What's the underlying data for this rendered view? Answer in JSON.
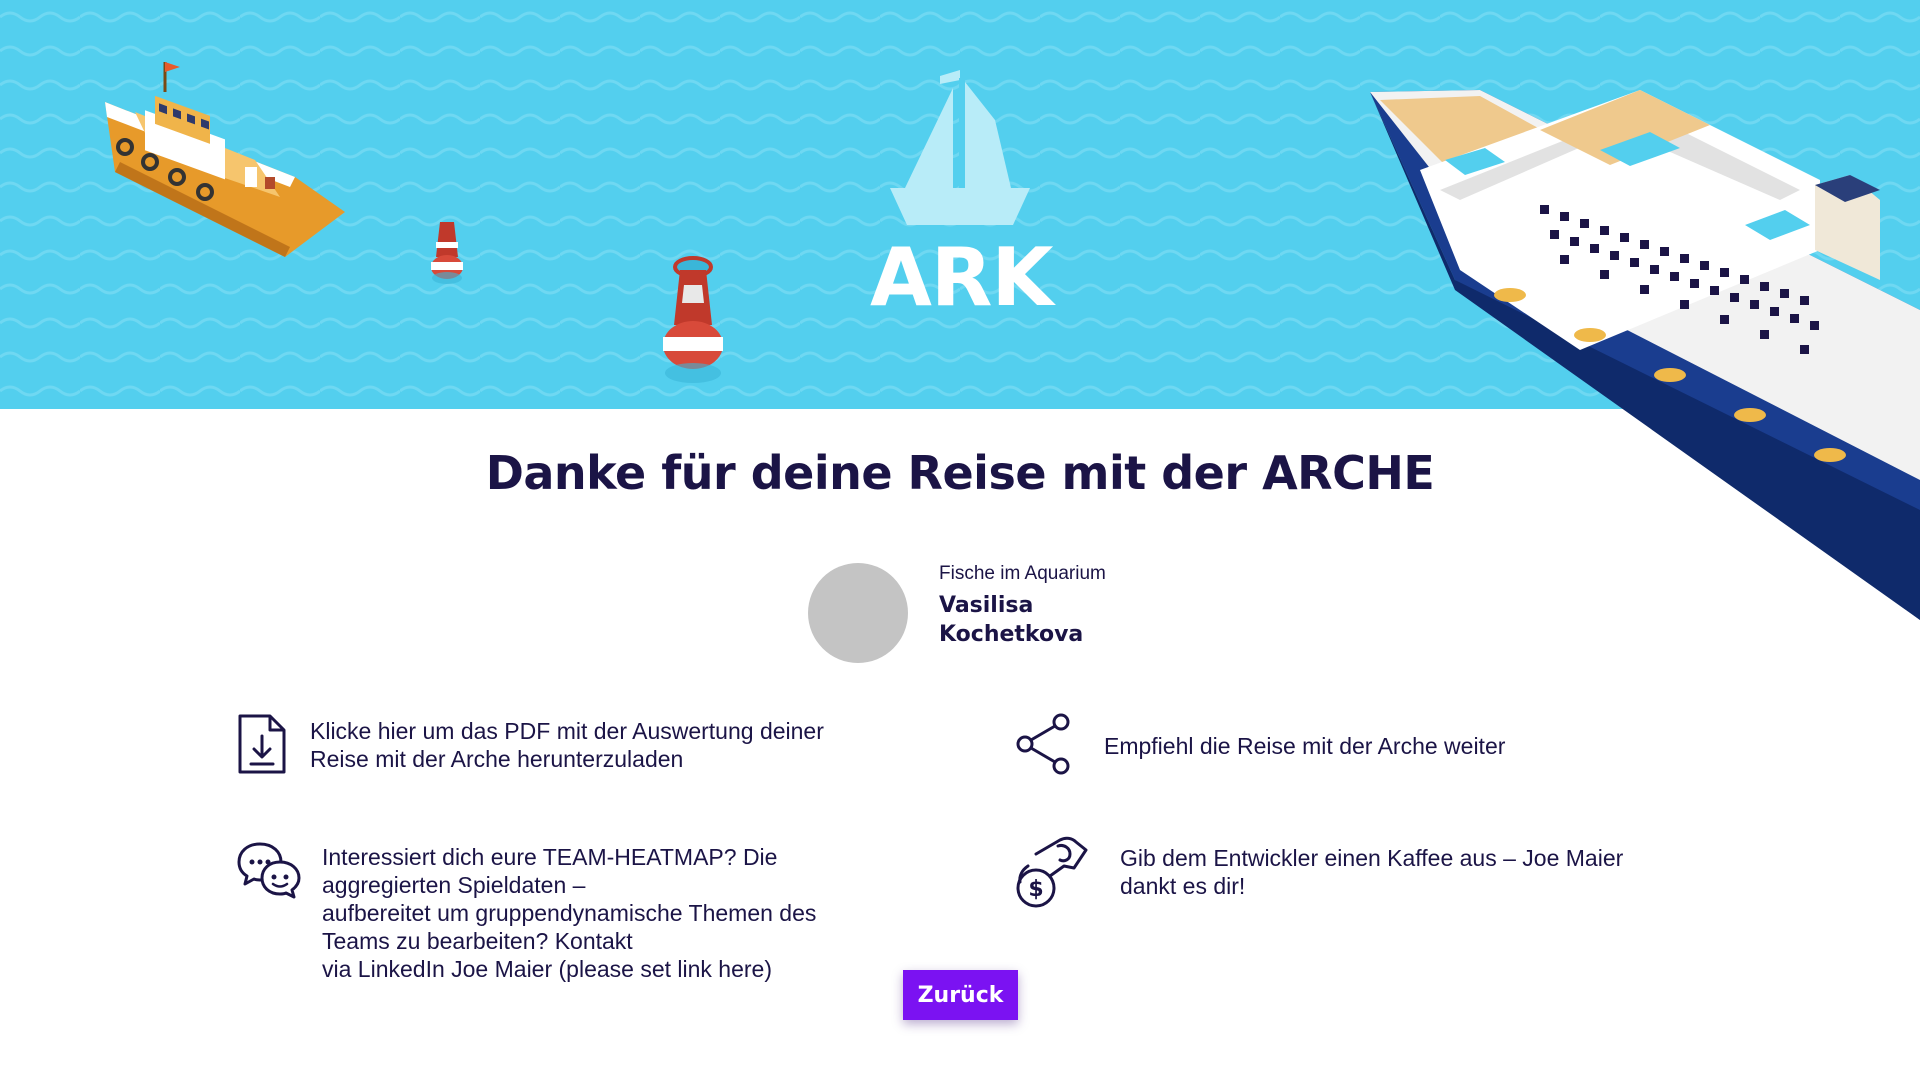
{
  "header": {
    "logo_text": "ARK"
  },
  "main": {
    "title": "Danke für deine Reise mit der ARCHE",
    "player": {
      "team": "Fische im Aquarium",
      "name": "Vasilisa Kochetkova"
    },
    "actions": {
      "pdf": "Klicke hier um das PDF mit der Auswertung deiner\nReise mit der Arche herunterzuladen",
      "share": "Empfiehl die Reise mit der Arche weiter",
      "heatmap": "Interessiert dich eure TEAM-HEATMAP? Die\naggregierten Spieldaten –\naufbereitet um gruppendynamische Themen des\nTeams zu bearbeiten? Kontakt\nvia LinkedIn Joe Maier (please set link here)",
      "coffee": "Gib dem Entwickler einen Kaffee aus – Joe Maier\ndankt es dir!"
    },
    "back_label": "Zurück"
  },
  "colors": {
    "sea": "#53cfee",
    "text": "#1b1446",
    "accent": "#7b12f2",
    "avatar_placeholder": "#c4c4c4"
  },
  "icons": {
    "pdf": "file-download-icon",
    "share": "share-icon",
    "heatmap": "chat-bubbles-icon",
    "coffee": "hand-coin-icon"
  }
}
